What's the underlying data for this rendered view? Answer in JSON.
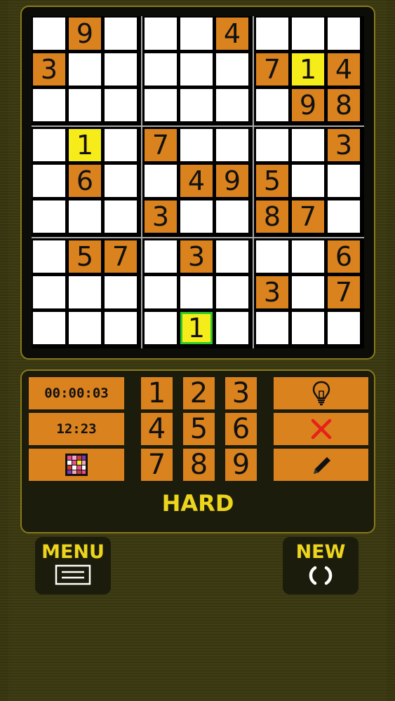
{
  "board": {
    "rows": [
      [
        "",
        "9",
        "",
        "",
        "",
        "4",
        "",
        "",
        ""
      ],
      [
        "3",
        "",
        "",
        "",
        "",
        "",
        "7",
        "1",
        "4"
      ],
      [
        "",
        "",
        "",
        "",
        "",
        "",
        "",
        "9",
        "8"
      ],
      [
        "",
        "1",
        "",
        "7",
        "",
        "",
        "",
        "",
        "3"
      ],
      [
        "",
        "6",
        "",
        "",
        "4",
        "9",
        "5",
        "",
        ""
      ],
      [
        "",
        "",
        "",
        "3",
        "",
        "",
        "8",
        "7",
        ""
      ],
      [
        "",
        "5",
        "7",
        "",
        "3",
        "",
        "",
        "",
        "6"
      ],
      [
        "",
        "",
        "",
        "",
        "",
        "",
        "3",
        "",
        "7"
      ],
      [
        "",
        "",
        "",
        "",
        "1",
        "",
        "",
        "",
        ""
      ]
    ],
    "highlighted": [
      [
        1,
        7
      ],
      [
        3,
        1
      ]
    ],
    "selected": [
      8,
      4
    ],
    "colors": {
      "given": "#d9821e",
      "highlight": "#f6ec1a",
      "selection_border": "#2ec92a"
    }
  },
  "controls": {
    "timer": "00:00:03",
    "clock": "12:23",
    "palette_icon": "color-grid-icon",
    "numbers": [
      "1",
      "2",
      "3",
      "4",
      "5",
      "6",
      "7",
      "8",
      "9"
    ],
    "hint_icon": "lightbulb-icon",
    "erase_icon": "close-icon",
    "pencil_icon": "pencil-icon",
    "difficulty": "HARD"
  },
  "nav": {
    "menu_label": "MENU",
    "menu_icon": "menu-icon",
    "new_label": "NEW",
    "new_icon": "refresh-icon"
  }
}
